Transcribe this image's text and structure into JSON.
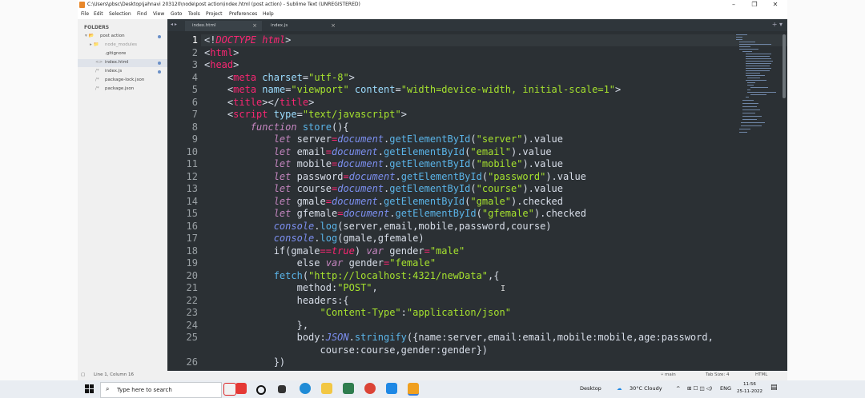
{
  "window": {
    "title": "C:\\Users\\pbsc\\Desktop\\jahnavi 203120\\node\\post action\\index.html (post action) - Sublime Text (UNREGISTERED)",
    "controls": {
      "minimize": "–",
      "restore": "❐",
      "close": "✕"
    }
  },
  "menu": [
    "File",
    "Edit",
    "Selection",
    "Find",
    "View",
    "Goto",
    "Tools",
    "Project",
    "Preferences",
    "Help"
  ],
  "sidebar": {
    "heading": "FOLDERS",
    "items": [
      {
        "label": "post action",
        "prefix": "▾ 📂"
      },
      {
        "label": "node_modules",
        "prefix": "▸ 📁"
      },
      {
        "label": ".gitignore",
        "prefix": ""
      },
      {
        "label": "index.html",
        "prefix": "<>"
      },
      {
        "label": "index.js",
        "prefix": "/*"
      },
      {
        "label": "package-lock.json",
        "prefix": "/*"
      },
      {
        "label": "package.json",
        "prefix": "/*"
      }
    ]
  },
  "tabs": [
    {
      "label": "index.html",
      "close": "×"
    },
    {
      "label": "index.js",
      "close": "×"
    }
  ],
  "tab_nav": "◂ ▸",
  "tab_plus": "+ ▾",
  "editor": {
    "line_numbers": [
      "1",
      "2",
      "3",
      "4",
      "5",
      "6",
      "7",
      "8",
      "9",
      "10",
      "11",
      "12",
      "13",
      "14",
      "15",
      "16",
      "17",
      "18",
      "19",
      "20",
      "21",
      "22",
      "23",
      "24",
      "25",
      "",
      "26"
    ],
    "current_line": 1
  },
  "status": {
    "position": "Line 1, Column 16",
    "branch": "⑂ main",
    "tab_size": "Tab Size: 4",
    "syntax": "HTML"
  },
  "taskbar": {
    "search_placeholder": "Type here to search",
    "desktop_label": "Desktop",
    "weather": "30°C Cloudy",
    "lang": "ENG",
    "time": "11:56",
    "date": "25-11-2022"
  },
  "colors": {
    "editor_bg": "#2b3034",
    "tag": "#f92672",
    "string": "#a6e22e",
    "attribute": "#9cdcfe",
    "function": "#5ab4e8",
    "object": "#7c8ff0",
    "keyword": "#c586c0"
  }
}
